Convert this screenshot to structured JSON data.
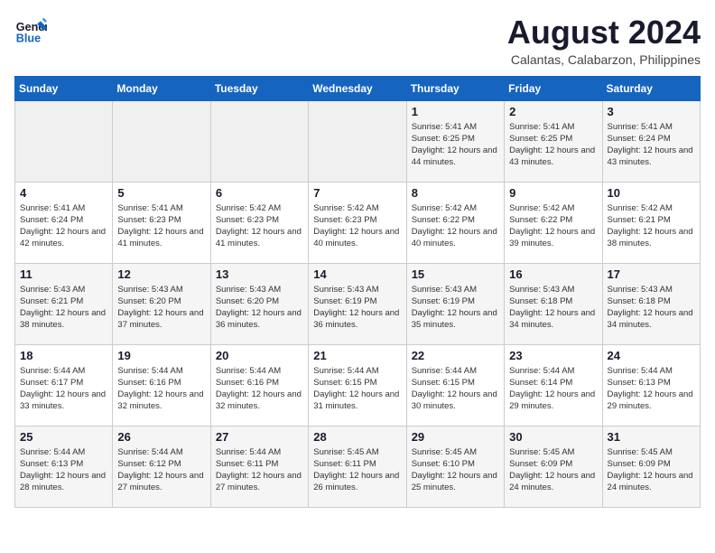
{
  "header": {
    "logo_line1": "General",
    "logo_line2": "Blue",
    "title": "August 2024",
    "subtitle": "Calantas, Calabarzon, Philippines"
  },
  "calendar": {
    "days_of_week": [
      "Sunday",
      "Monday",
      "Tuesday",
      "Wednesday",
      "Thursday",
      "Friday",
      "Saturday"
    ],
    "weeks": [
      [
        {
          "day": "",
          "info": ""
        },
        {
          "day": "",
          "info": ""
        },
        {
          "day": "",
          "info": ""
        },
        {
          "day": "",
          "info": ""
        },
        {
          "day": "1",
          "info": "Sunrise: 5:41 AM\nSunset: 6:25 PM\nDaylight: 12 hours\nand 44 minutes."
        },
        {
          "day": "2",
          "info": "Sunrise: 5:41 AM\nSunset: 6:25 PM\nDaylight: 12 hours\nand 43 minutes."
        },
        {
          "day": "3",
          "info": "Sunrise: 5:41 AM\nSunset: 6:24 PM\nDaylight: 12 hours\nand 43 minutes."
        }
      ],
      [
        {
          "day": "4",
          "info": "Sunrise: 5:41 AM\nSunset: 6:24 PM\nDaylight: 12 hours\nand 42 minutes."
        },
        {
          "day": "5",
          "info": "Sunrise: 5:41 AM\nSunset: 6:23 PM\nDaylight: 12 hours\nand 41 minutes."
        },
        {
          "day": "6",
          "info": "Sunrise: 5:42 AM\nSunset: 6:23 PM\nDaylight: 12 hours\nand 41 minutes."
        },
        {
          "day": "7",
          "info": "Sunrise: 5:42 AM\nSunset: 6:23 PM\nDaylight: 12 hours\nand 40 minutes."
        },
        {
          "day": "8",
          "info": "Sunrise: 5:42 AM\nSunset: 6:22 PM\nDaylight: 12 hours\nand 40 minutes."
        },
        {
          "day": "9",
          "info": "Sunrise: 5:42 AM\nSunset: 6:22 PM\nDaylight: 12 hours\nand 39 minutes."
        },
        {
          "day": "10",
          "info": "Sunrise: 5:42 AM\nSunset: 6:21 PM\nDaylight: 12 hours\nand 38 minutes."
        }
      ],
      [
        {
          "day": "11",
          "info": "Sunrise: 5:43 AM\nSunset: 6:21 PM\nDaylight: 12 hours\nand 38 minutes."
        },
        {
          "day": "12",
          "info": "Sunrise: 5:43 AM\nSunset: 6:20 PM\nDaylight: 12 hours\nand 37 minutes."
        },
        {
          "day": "13",
          "info": "Sunrise: 5:43 AM\nSunset: 6:20 PM\nDaylight: 12 hours\nand 36 minutes."
        },
        {
          "day": "14",
          "info": "Sunrise: 5:43 AM\nSunset: 6:19 PM\nDaylight: 12 hours\nand 36 minutes."
        },
        {
          "day": "15",
          "info": "Sunrise: 5:43 AM\nSunset: 6:19 PM\nDaylight: 12 hours\nand 35 minutes."
        },
        {
          "day": "16",
          "info": "Sunrise: 5:43 AM\nSunset: 6:18 PM\nDaylight: 12 hours\nand 34 minutes."
        },
        {
          "day": "17",
          "info": "Sunrise: 5:43 AM\nSunset: 6:18 PM\nDaylight: 12 hours\nand 34 minutes."
        }
      ],
      [
        {
          "day": "18",
          "info": "Sunrise: 5:44 AM\nSunset: 6:17 PM\nDaylight: 12 hours\nand 33 minutes."
        },
        {
          "day": "19",
          "info": "Sunrise: 5:44 AM\nSunset: 6:16 PM\nDaylight: 12 hours\nand 32 minutes."
        },
        {
          "day": "20",
          "info": "Sunrise: 5:44 AM\nSunset: 6:16 PM\nDaylight: 12 hours\nand 32 minutes."
        },
        {
          "day": "21",
          "info": "Sunrise: 5:44 AM\nSunset: 6:15 PM\nDaylight: 12 hours\nand 31 minutes."
        },
        {
          "day": "22",
          "info": "Sunrise: 5:44 AM\nSunset: 6:15 PM\nDaylight: 12 hours\nand 30 minutes."
        },
        {
          "day": "23",
          "info": "Sunrise: 5:44 AM\nSunset: 6:14 PM\nDaylight: 12 hours\nand 29 minutes."
        },
        {
          "day": "24",
          "info": "Sunrise: 5:44 AM\nSunset: 6:13 PM\nDaylight: 12 hours\nand 29 minutes."
        }
      ],
      [
        {
          "day": "25",
          "info": "Sunrise: 5:44 AM\nSunset: 6:13 PM\nDaylight: 12 hours\nand 28 minutes."
        },
        {
          "day": "26",
          "info": "Sunrise: 5:44 AM\nSunset: 6:12 PM\nDaylight: 12 hours\nand 27 minutes."
        },
        {
          "day": "27",
          "info": "Sunrise: 5:44 AM\nSunset: 6:11 PM\nDaylight: 12 hours\nand 27 minutes."
        },
        {
          "day": "28",
          "info": "Sunrise: 5:45 AM\nSunset: 6:11 PM\nDaylight: 12 hours\nand 26 minutes."
        },
        {
          "day": "29",
          "info": "Sunrise: 5:45 AM\nSunset: 6:10 PM\nDaylight: 12 hours\nand 25 minutes."
        },
        {
          "day": "30",
          "info": "Sunrise: 5:45 AM\nSunset: 6:09 PM\nDaylight: 12 hours\nand 24 minutes."
        },
        {
          "day": "31",
          "info": "Sunrise: 5:45 AM\nSunset: 6:09 PM\nDaylight: 12 hours\nand 24 minutes."
        }
      ]
    ]
  }
}
